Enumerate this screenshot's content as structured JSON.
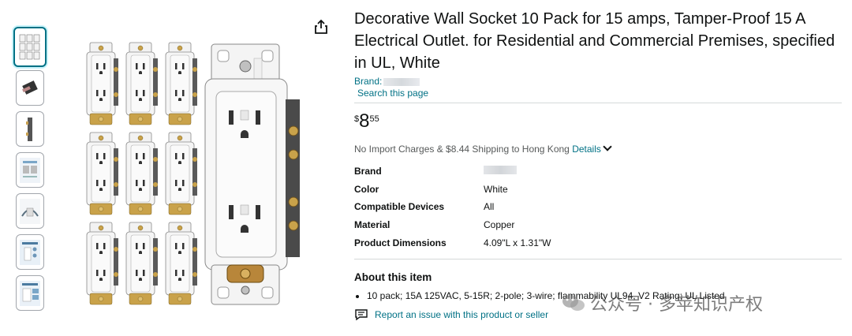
{
  "product": {
    "title": "Decorative Wall Socket 10 Pack for 15 amps, Tamper-Proof 15 A Electrical Outlet. for Residential and Commercial Premises, specified in UL, White",
    "brand_label": "Brand:",
    "search_link": "Search this page",
    "price": {
      "symbol": "$",
      "whole": "8",
      "fraction": "55"
    },
    "shipping_text": "No Import Charges & $8.44 Shipping to Hong Kong",
    "details_link": "Details"
  },
  "specs": [
    {
      "key": "Brand",
      "value": ""
    },
    {
      "key": "Color",
      "value": "White"
    },
    {
      "key": "Compatible Devices",
      "value": "All"
    },
    {
      "key": "Material",
      "value": "Copper"
    },
    {
      "key": "Product Dimensions",
      "value": "4.09\"L x 1.31\"W"
    }
  ],
  "about": {
    "title": "About this item",
    "bullets": [
      "10 pack; 15A 125VAC, 5-15R; 2-pole; 3-wire; flammability UL94, V2 Rating; UL Listed"
    ]
  },
  "report_link": "Report an issue with this product or seller",
  "watermark": "公众号 · 多苹知识产权",
  "icons": {
    "share": "share-icon",
    "report": "report-icon",
    "chevron": "chevron-down-icon"
  },
  "colors": {
    "link": "#007185",
    "selected_border": "#007185",
    "text": "#0f1111",
    "muted": "#565959"
  }
}
